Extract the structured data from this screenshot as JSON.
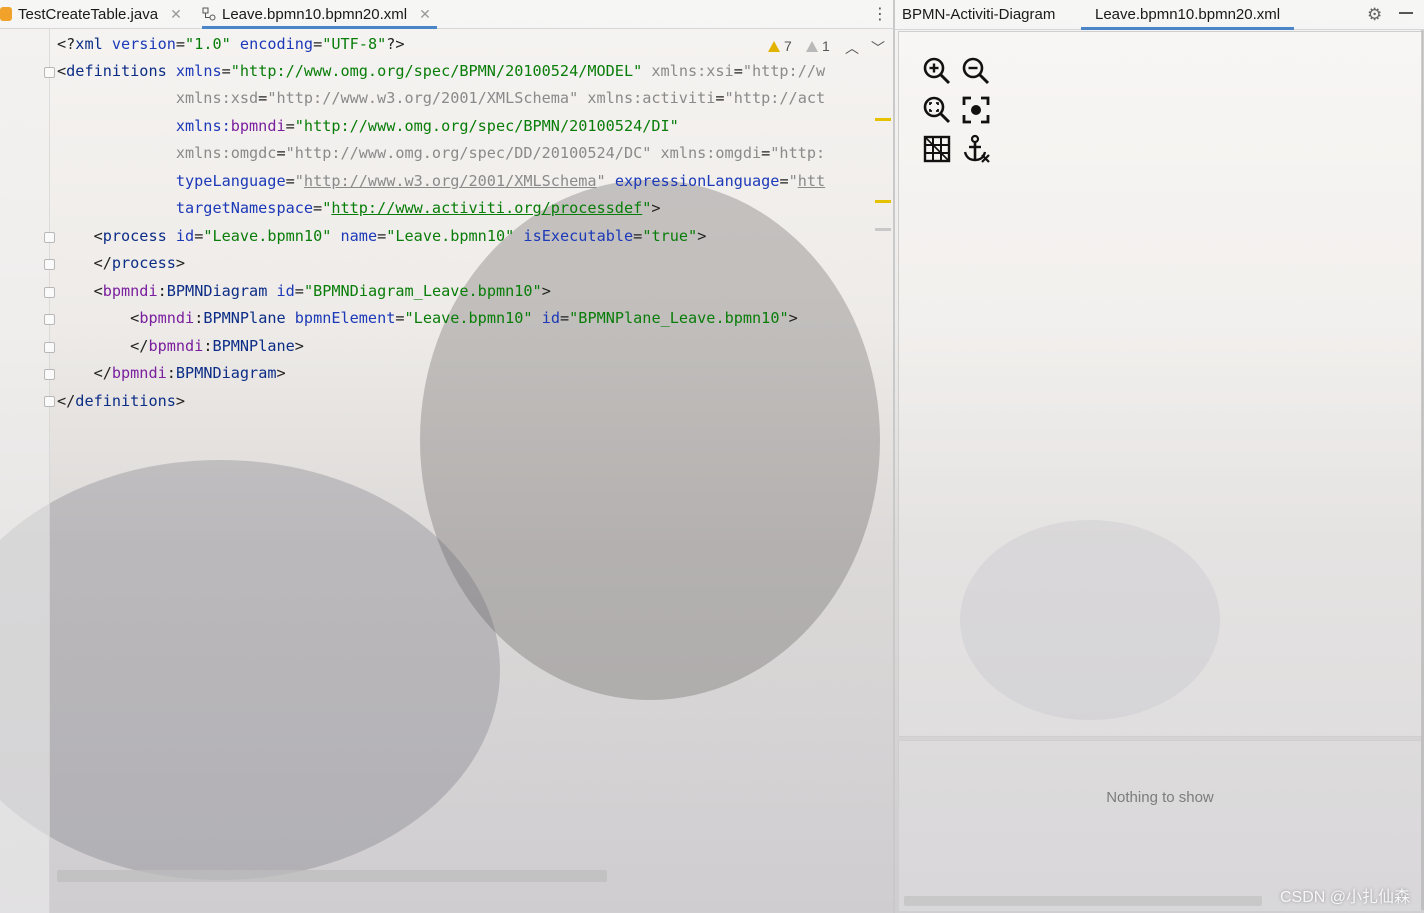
{
  "editor": {
    "tabs": [
      {
        "label": "TestCreateTable.java",
        "icon": "java-class-icon"
      },
      {
        "label": "Leave.bpmn10.bpmn20.xml",
        "icon": "bpmn-xml-icon"
      }
    ],
    "inspections": {
      "warnings": "7",
      "weak_warnings": "1"
    },
    "code_lines": [
      "<?xml version=\"1.0\" encoding=\"UTF-8\"?>",
      "<definitions xmlns=\"http://www.omg.org/spec/BPMN/20100524/MODEL\" xmlns:xsi=\"http://w",
      "             xmlns:xsd=\"http://www.w3.org/2001/XMLSchema\" xmlns:activiti=\"http://act",
      "             xmlns:bpmndi=\"http://www.omg.org/spec/BPMN/20100524/DI\"",
      "             xmlns:omgdc=\"http://www.omg.org/spec/DD/20100524/DC\" xmlns:omgdi=\"http:",
      "             typeLanguage=\"http://www.w3.org/2001/XMLSchema\" expressionLanguage=\"htt",
      "             targetNamespace=\"http://www.activiti.org/processdef\">",
      "    <process id=\"Leave.bpmn10\" name=\"Leave.bpmn10\" isExecutable=\"true\">",
      "    </process>",
      "    <bpmndi:BPMNDiagram id=\"BPMNDiagram_Leave.bpmn10\">",
      "        <bpmndi:BPMNPlane bpmnElement=\"Leave.bpmn10\" id=\"BPMNPlane_Leave.bpmn10\">",
      "        </bpmndi:BPMNPlane>",
      "    </bpmndi:BPMNDiagram>",
      "</definitions>"
    ]
  },
  "right_panel": {
    "tabs": [
      {
        "label": "BPMN-Activiti-Diagram"
      },
      {
        "label": "Leave.bpmn10.bpmn20.xml"
      }
    ],
    "toolbar": [
      "zoom-in-icon",
      "zoom-out-icon",
      "zoom-reset-icon",
      "zoom-fit-icon",
      "grid-icon",
      "anchor-icon"
    ],
    "properties_empty": "Nothing to show"
  },
  "watermark": "CSDN @小扎仙森",
  "colors": {
    "accent": "#4a86c7",
    "tag": "#0b2d86",
    "attr": "#1c39b8",
    "value": "#097d09",
    "namespace": "#7a1f9e",
    "warning": "#e2b200"
  }
}
